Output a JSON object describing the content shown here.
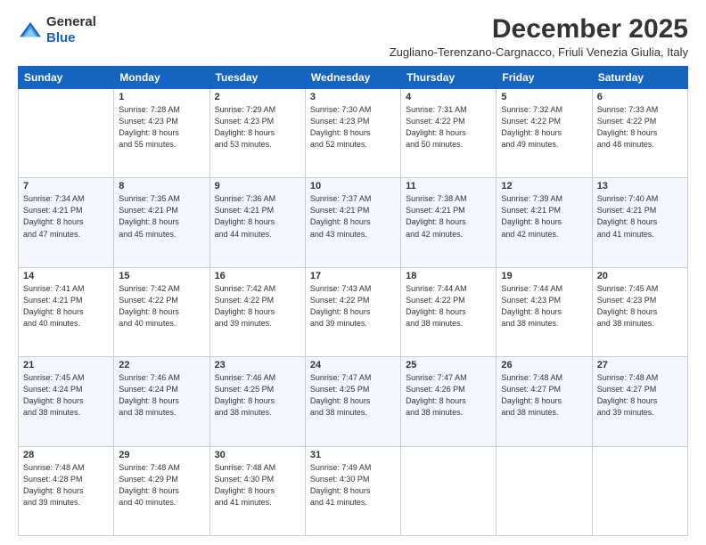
{
  "logo": {
    "general": "General",
    "blue": "Blue"
  },
  "header": {
    "title": "December 2025",
    "subtitle": "Zugliano-Terenzano-Cargnacco, Friuli Venezia Giulia, Italy"
  },
  "days_of_week": [
    "Sunday",
    "Monday",
    "Tuesday",
    "Wednesday",
    "Thursday",
    "Friday",
    "Saturday"
  ],
  "weeks": [
    {
      "days": [
        {
          "num": "",
          "info": ""
        },
        {
          "num": "1",
          "info": "Sunrise: 7:28 AM\nSunset: 4:23 PM\nDaylight: 8 hours\nand 55 minutes."
        },
        {
          "num": "2",
          "info": "Sunrise: 7:29 AM\nSunset: 4:23 PM\nDaylight: 8 hours\nand 53 minutes."
        },
        {
          "num": "3",
          "info": "Sunrise: 7:30 AM\nSunset: 4:23 PM\nDaylight: 8 hours\nand 52 minutes."
        },
        {
          "num": "4",
          "info": "Sunrise: 7:31 AM\nSunset: 4:22 PM\nDaylight: 8 hours\nand 50 minutes."
        },
        {
          "num": "5",
          "info": "Sunrise: 7:32 AM\nSunset: 4:22 PM\nDaylight: 8 hours\nand 49 minutes."
        },
        {
          "num": "6",
          "info": "Sunrise: 7:33 AM\nSunset: 4:22 PM\nDaylight: 8 hours\nand 48 minutes."
        }
      ]
    },
    {
      "days": [
        {
          "num": "7",
          "info": "Sunrise: 7:34 AM\nSunset: 4:21 PM\nDaylight: 8 hours\nand 47 minutes."
        },
        {
          "num": "8",
          "info": "Sunrise: 7:35 AM\nSunset: 4:21 PM\nDaylight: 8 hours\nand 45 minutes."
        },
        {
          "num": "9",
          "info": "Sunrise: 7:36 AM\nSunset: 4:21 PM\nDaylight: 8 hours\nand 44 minutes."
        },
        {
          "num": "10",
          "info": "Sunrise: 7:37 AM\nSunset: 4:21 PM\nDaylight: 8 hours\nand 43 minutes."
        },
        {
          "num": "11",
          "info": "Sunrise: 7:38 AM\nSunset: 4:21 PM\nDaylight: 8 hours\nand 42 minutes."
        },
        {
          "num": "12",
          "info": "Sunrise: 7:39 AM\nSunset: 4:21 PM\nDaylight: 8 hours\nand 42 minutes."
        },
        {
          "num": "13",
          "info": "Sunrise: 7:40 AM\nSunset: 4:21 PM\nDaylight: 8 hours\nand 41 minutes."
        }
      ]
    },
    {
      "days": [
        {
          "num": "14",
          "info": "Sunrise: 7:41 AM\nSunset: 4:21 PM\nDaylight: 8 hours\nand 40 minutes."
        },
        {
          "num": "15",
          "info": "Sunrise: 7:42 AM\nSunset: 4:22 PM\nDaylight: 8 hours\nand 40 minutes."
        },
        {
          "num": "16",
          "info": "Sunrise: 7:42 AM\nSunset: 4:22 PM\nDaylight: 8 hours\nand 39 minutes."
        },
        {
          "num": "17",
          "info": "Sunrise: 7:43 AM\nSunset: 4:22 PM\nDaylight: 8 hours\nand 39 minutes."
        },
        {
          "num": "18",
          "info": "Sunrise: 7:44 AM\nSunset: 4:22 PM\nDaylight: 8 hours\nand 38 minutes."
        },
        {
          "num": "19",
          "info": "Sunrise: 7:44 AM\nSunset: 4:23 PM\nDaylight: 8 hours\nand 38 minutes."
        },
        {
          "num": "20",
          "info": "Sunrise: 7:45 AM\nSunset: 4:23 PM\nDaylight: 8 hours\nand 38 minutes."
        }
      ]
    },
    {
      "days": [
        {
          "num": "21",
          "info": "Sunrise: 7:45 AM\nSunset: 4:24 PM\nDaylight: 8 hours\nand 38 minutes."
        },
        {
          "num": "22",
          "info": "Sunrise: 7:46 AM\nSunset: 4:24 PM\nDaylight: 8 hours\nand 38 minutes."
        },
        {
          "num": "23",
          "info": "Sunrise: 7:46 AM\nSunset: 4:25 PM\nDaylight: 8 hours\nand 38 minutes."
        },
        {
          "num": "24",
          "info": "Sunrise: 7:47 AM\nSunset: 4:25 PM\nDaylight: 8 hours\nand 38 minutes."
        },
        {
          "num": "25",
          "info": "Sunrise: 7:47 AM\nSunset: 4:26 PM\nDaylight: 8 hours\nand 38 minutes."
        },
        {
          "num": "26",
          "info": "Sunrise: 7:48 AM\nSunset: 4:27 PM\nDaylight: 8 hours\nand 38 minutes."
        },
        {
          "num": "27",
          "info": "Sunrise: 7:48 AM\nSunset: 4:27 PM\nDaylight: 8 hours\nand 39 minutes."
        }
      ]
    },
    {
      "days": [
        {
          "num": "28",
          "info": "Sunrise: 7:48 AM\nSunset: 4:28 PM\nDaylight: 8 hours\nand 39 minutes."
        },
        {
          "num": "29",
          "info": "Sunrise: 7:48 AM\nSunset: 4:29 PM\nDaylight: 8 hours\nand 40 minutes."
        },
        {
          "num": "30",
          "info": "Sunrise: 7:48 AM\nSunset: 4:30 PM\nDaylight: 8 hours\nand 41 minutes."
        },
        {
          "num": "31",
          "info": "Sunrise: 7:49 AM\nSunset: 4:30 PM\nDaylight: 8 hours\nand 41 minutes."
        },
        {
          "num": "",
          "info": ""
        },
        {
          "num": "",
          "info": ""
        },
        {
          "num": "",
          "info": ""
        }
      ]
    }
  ]
}
